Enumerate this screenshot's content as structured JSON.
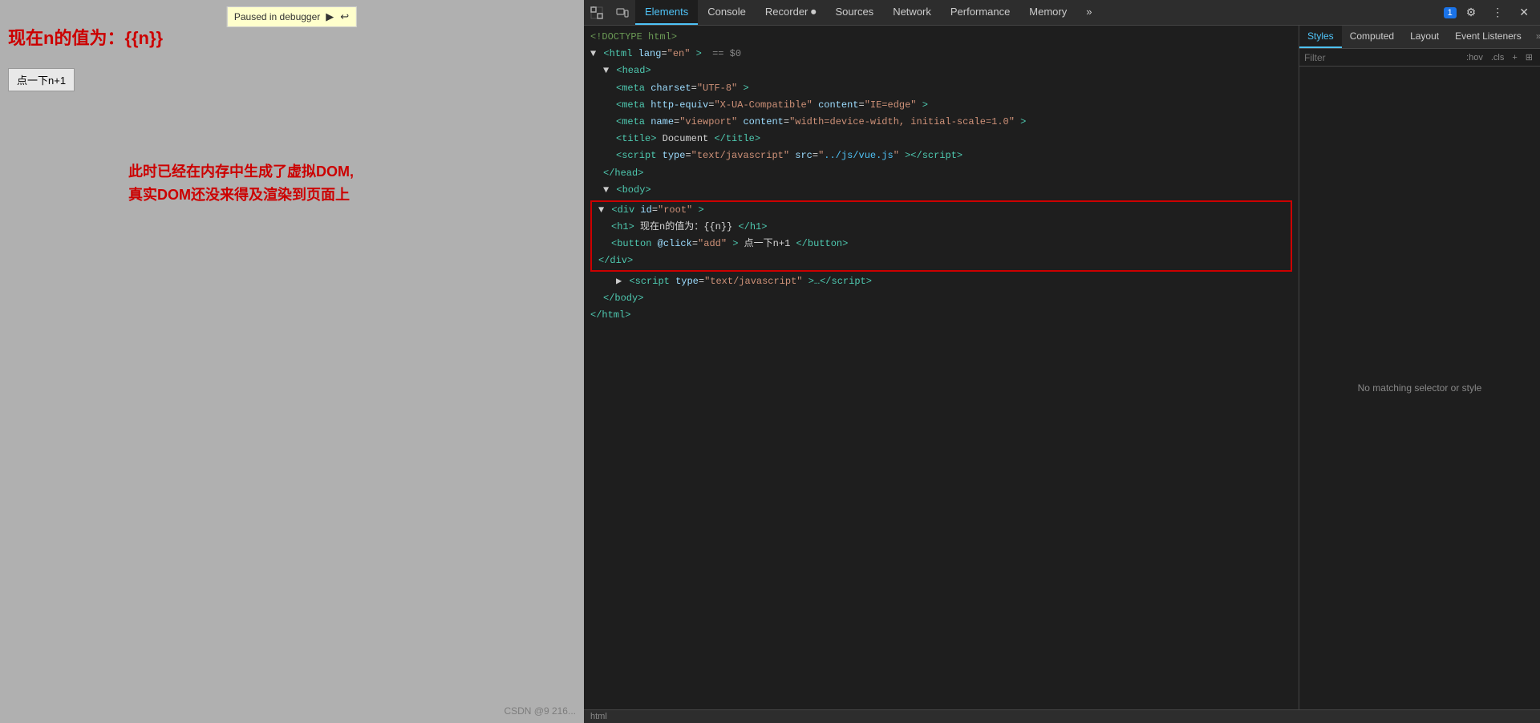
{
  "webpage": {
    "title": "现在n的值为：{{n}}",
    "button_label": "点一下n+1",
    "annotation_line1": "此时已经在内存中生成了虚拟DOM,",
    "annotation_line2": "真实DOM还没来得及渲染到页面上"
  },
  "debugger": {
    "banner_text": "Paused in debugger",
    "resume_icon": "▶",
    "step_icon": "↩"
  },
  "devtools": {
    "tabs": [
      {
        "label": "Elements",
        "active": true
      },
      {
        "label": "Console",
        "active": false
      },
      {
        "label": "Recorder ⏺",
        "active": false
      },
      {
        "label": "Sources",
        "active": false
      },
      {
        "label": "Network",
        "active": false
      },
      {
        "label": "Performance",
        "active": false
      },
      {
        "label": "Memory",
        "active": false
      },
      {
        "label": "»",
        "active": false
      }
    ],
    "dom": {
      "doctype": "<!DOCTYPE html>",
      "html_tag": "<html lang=\"en\"> == $0",
      "head": "<head>",
      "meta_charset": "<meta charset=\"UTF-8\">",
      "meta_compat": "<meta http-equiv=\"X-UA-Compatible\" content=\"IE=edge\">",
      "meta_viewport": "<meta name=\"viewport\" content=\"width=device-width, initial-scale=1.0\">",
      "title": "<title>Document</title>",
      "script_src": "<script type=\"text/javascript\" src=\"../js/vue.js\"></script>",
      "head_close": "</head>",
      "body_open": "<body>",
      "div_root": "<div id=\"root\">",
      "h1": "<h1>现在n的值为：{{n}}</h1>",
      "button": "<button @click=\"add\">点一下n+1</button>",
      "div_close": "</div>",
      "script_inline": "<script type=\"text/javascript\">…</script>",
      "body_close": "</body>",
      "html_close": "</html>"
    },
    "styles": {
      "tabs": [
        {
          "label": "Styles",
          "active": true
        },
        {
          "label": "Computed",
          "active": false
        },
        {
          "label": "Layout",
          "active": false
        },
        {
          "label": "Event Listeners",
          "active": false
        },
        {
          "label": "»",
          "active": false
        }
      ],
      "filter_placeholder": "Filter",
      "hov_btn": ":hov",
      "cls_btn": ".cls",
      "add_btn": "+",
      "empty_message": "No matching selector or style"
    }
  },
  "statusbar": {
    "selected_path": "html",
    "watermark": "CSDN @9 216..."
  }
}
